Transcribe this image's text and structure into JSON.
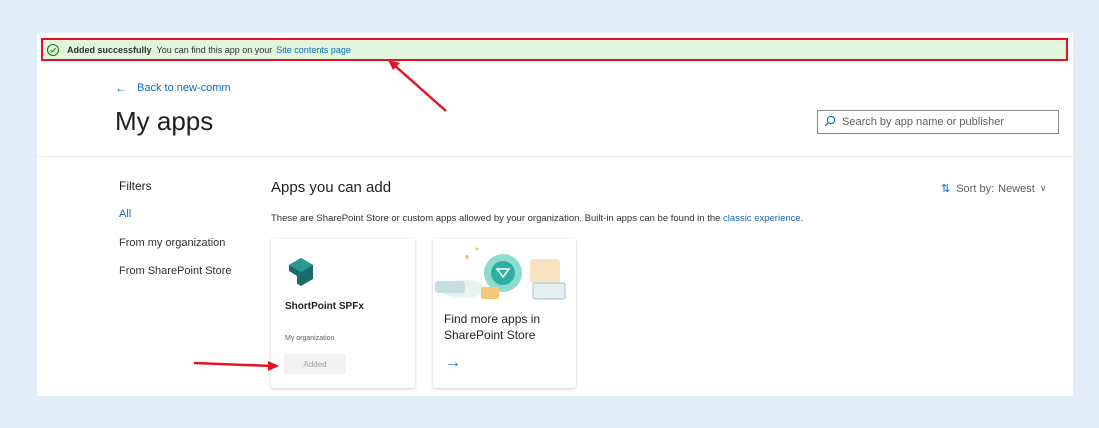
{
  "banner": {
    "title": "Added successfully",
    "message": "You can find this app on your",
    "link": "Site contents page"
  },
  "back_link": "Back to new-comm",
  "page_title": "My apps",
  "search": {
    "placeholder": "Search by app name or publisher"
  },
  "filters": {
    "title": "Filters",
    "items": [
      {
        "label": "All",
        "active": true
      },
      {
        "label": "From my organization",
        "active": false
      },
      {
        "label": "From SharePoint Store",
        "active": false
      }
    ]
  },
  "section": {
    "title": "Apps you can add",
    "sort_label": "Sort by:",
    "sort_value": "Newest",
    "description": "These are SharePoint Store or custom apps allowed by your organization. Built-in apps can be found in the",
    "description_link": "classic experience",
    "description_end": "."
  },
  "cards": [
    {
      "name": "ShortPoint SPFx",
      "owner": "My organization",
      "status": "Added"
    },
    {
      "line1": "Find more apps in",
      "line2": "SharePoint Store"
    }
  ],
  "colors": {
    "accent": "#0f6cbd",
    "success_bg": "#dff6dd",
    "annotation_red": "#e81123",
    "page_bg": "#e1edf9"
  }
}
